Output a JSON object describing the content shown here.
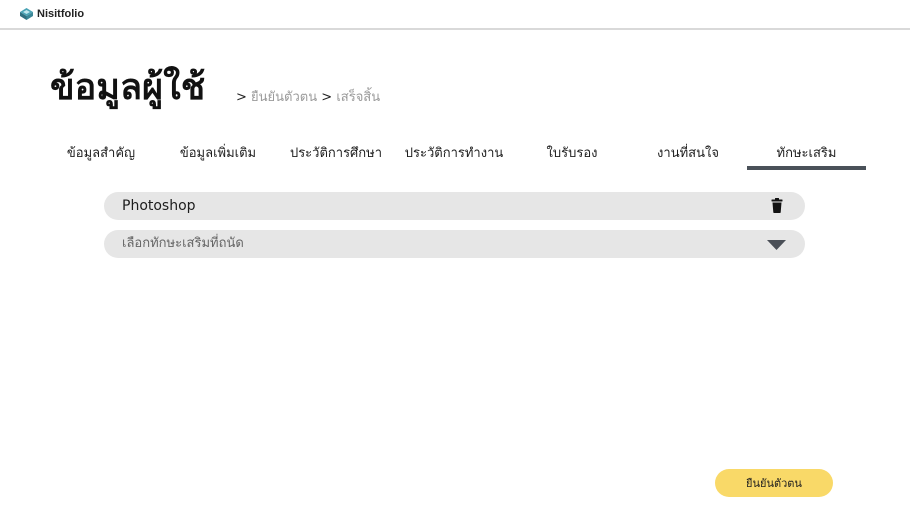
{
  "app": {
    "name": "Nisitfolio"
  },
  "page": {
    "title": "ข้อมูลผู้ใช้"
  },
  "breadcrumb": {
    "separator": ">",
    "steps": [
      "ยืนยันตัวตน",
      "เสร็จสิ้น"
    ]
  },
  "tabs": [
    {
      "label": "ข้อมูลสำคัญ",
      "active": false
    },
    {
      "label": "ข้อมูลเพิ่มเติม",
      "active": false
    },
    {
      "label": "ประวัติการศึกษา",
      "active": false
    },
    {
      "label": "ประวัติการทำงาน",
      "active": false
    },
    {
      "label": "ใบรับรอง",
      "active": false
    },
    {
      "label": "งานที่สนใจ",
      "active": false
    },
    {
      "label": "ทักษะเสริม",
      "active": true
    }
  ],
  "skills": {
    "items": [
      {
        "name": "Photoshop",
        "action_icon": "trash-icon"
      }
    ],
    "select": {
      "placeholder": "เลือกทักษะเสริมที่ถนัด",
      "icon": "caret-down-icon"
    }
  },
  "footer": {
    "confirm_label": "ยืนยันตัวตน"
  },
  "colors": {
    "accent_button": "#f9d968",
    "tab_underline": "#4a5159",
    "row_background": "#e6e6e6",
    "breadcrumb_muted": "#9a9a9a"
  }
}
